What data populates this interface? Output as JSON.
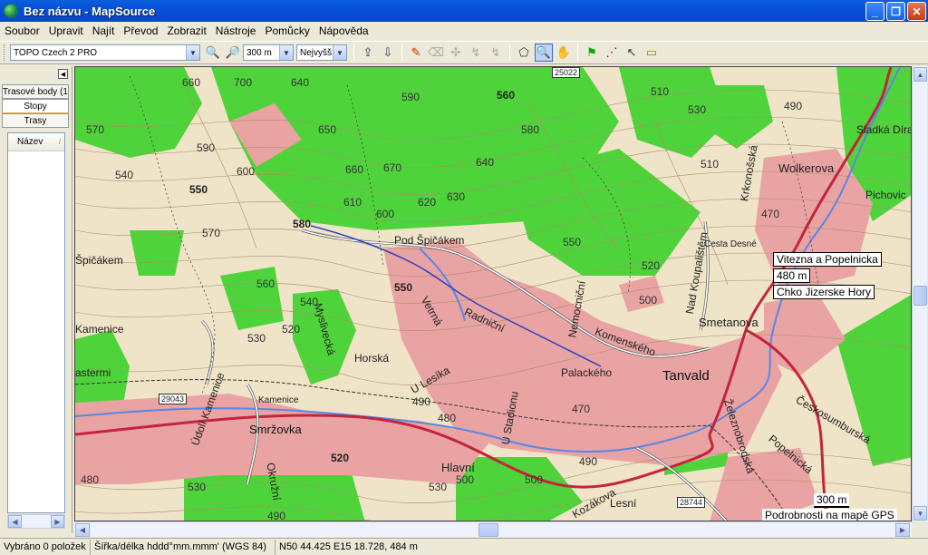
{
  "window": {
    "title": "Bez názvu - MapSource"
  },
  "menu": [
    "Soubor",
    "Upravit",
    "Najít",
    "Převod",
    "Zobrazit",
    "Nástroje",
    "Pomůcky",
    "Nápověda"
  ],
  "toolbar": {
    "map_product": "TOPO Czech 2 PRO",
    "zoom_scale": "300 m",
    "detail_level": "Nejvyšší"
  },
  "left_panel": {
    "tabs": [
      "Trasové body (1",
      "Stopy",
      "Trasy"
    ],
    "column_header": "Název"
  },
  "map": {
    "towns": [
      "Tanvald",
      "Smržovka",
      "Smetanova",
      "Wolkerova",
      "Sladká Díra",
      "Pichovic"
    ],
    "streets": [
      "Pod Špičákem",
      "Radniční",
      "Vetrná",
      "Komenského",
      "Palackého",
      "Horská",
      "U Lesíka",
      "Myslivecká",
      "U Stadionu",
      "Nemocniční",
      "Nad Koupalištěm",
      "Hlavní",
      "Železnobrodská",
      "Českosumburská",
      "Popelnická",
      "Kamenice",
      "Údolí Kamenice",
      "Okružní",
      "Kozákova",
      "Lesní",
      "Cesta Desné",
      "Krkonošská",
      "Špičákem",
      "Kamenice",
      "astermi"
    ],
    "contours": [
      "660",
      "700",
      "640",
      "590",
      "560",
      "510",
      "530",
      "490",
      "570",
      "650",
      "580",
      "590",
      "600",
      "660",
      "670",
      "640",
      "540",
      "550",
      "610",
      "620",
      "630",
      "600",
      "580",
      "570",
      "550",
      "560",
      "520",
      "530",
      "510",
      "500",
      "470",
      "540",
      "550",
      "490",
      "480",
      "470",
      "520",
      "500",
      "490",
      "480",
      "530",
      "520",
      "530",
      "500",
      "490"
    ],
    "road_numbers": [
      "25022",
      "29043",
      "28744"
    ],
    "info_box": [
      "Vitezna a Popelnicka",
      "480 m",
      "Chko Jizerske Hory"
    ],
    "scale_label": "300 m",
    "detail_note": "Podrobnosti na mapě GPS"
  },
  "status": {
    "selection": "Vybráno 0 položek",
    "coordinate_format": "Šířka/délka hddd°mm.mmm' (WGS 84)",
    "cursor_position": "N50 44.425 E15 18.728, 484 m"
  }
}
